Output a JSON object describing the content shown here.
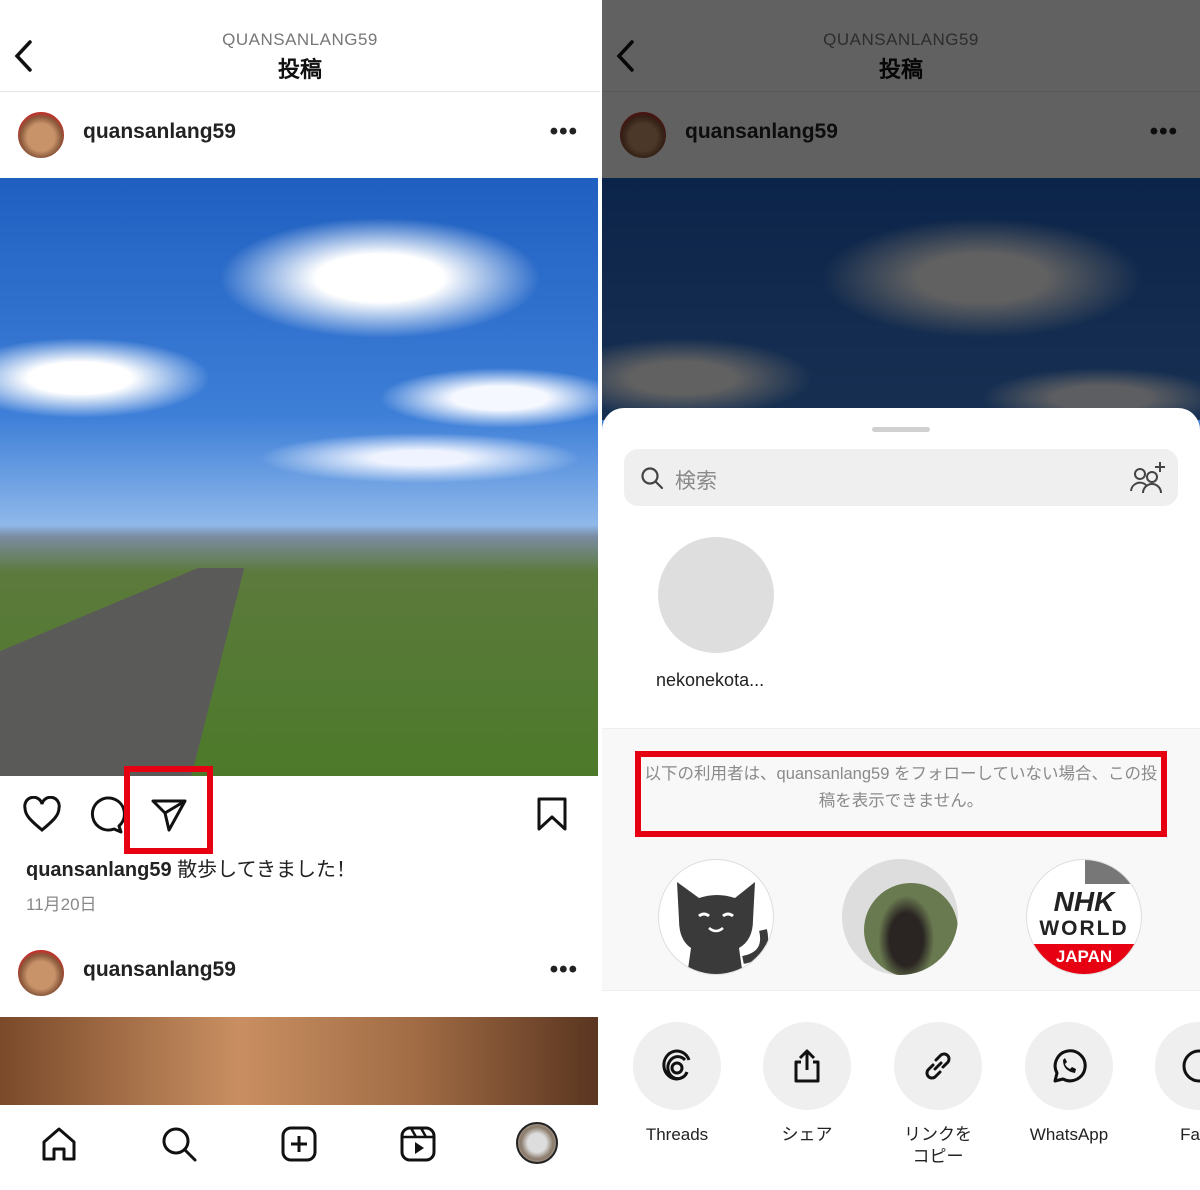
{
  "header": {
    "account": "QUANSANLANG59",
    "title": "投稿"
  },
  "post": {
    "username": "quansanlang59",
    "caption": "散歩してきました！",
    "date": "11月20日"
  },
  "next_post": {
    "username": "quansanlang59"
  },
  "share_sheet": {
    "search_placeholder": "検索",
    "contact": "nekonekota...",
    "notice": "以下の利用者は、quansanlang59 をフォローしていない場合、この投稿を表示できません。",
    "restricted_users": [
      "cat-avatar",
      "horse-avatar",
      "nhk-world-japan-avatar"
    ],
    "nhk_logo": {
      "line1": "NHK",
      "line2": "WORLD",
      "line3": "JAPAN"
    },
    "share_options": [
      {
        "label": "Threads",
        "icon": "threads-icon"
      },
      {
        "label": "シェア",
        "icon": "share-icon"
      },
      {
        "label": "リンクを\nコピー",
        "icon": "link-icon"
      },
      {
        "label": "WhatsApp",
        "icon": "whatsapp-icon"
      },
      {
        "label": "Face",
        "icon": "facebook-icon"
      }
    ]
  },
  "colors": {
    "highlight": "#e60012"
  }
}
